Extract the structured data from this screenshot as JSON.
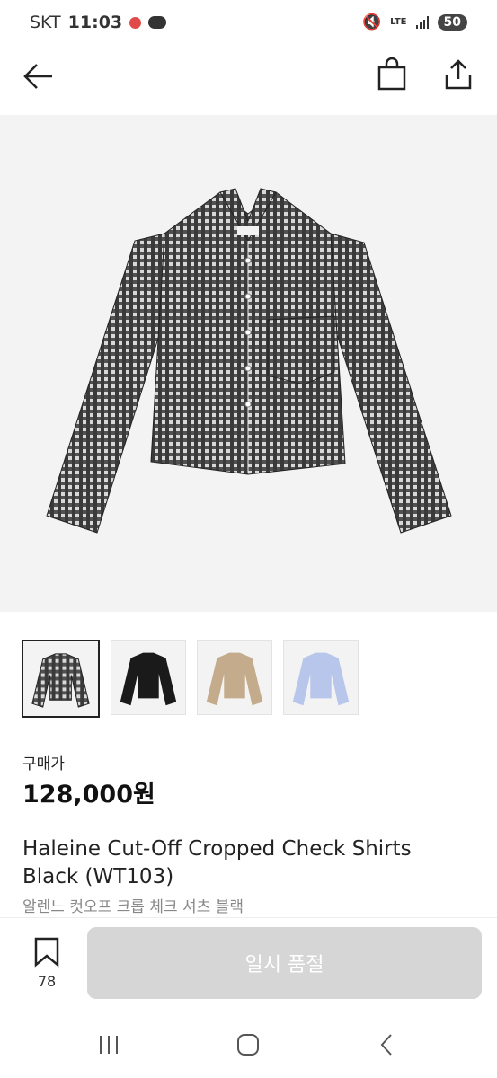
{
  "status_bar": {
    "carrier": "SKT",
    "time": "11:03",
    "network": "LTE",
    "battery": "50"
  },
  "app_bar": {
    "back_icon": "back-arrow-icon",
    "bag_icon": "shopping-bag-icon",
    "share_icon": "share-icon"
  },
  "product": {
    "price_label": "구매가",
    "price": "128,000원",
    "title": "Haleine Cut-Off Cropped Check Shirts Black (WT103)",
    "subtitle": "알렌느 컷오프 크롭 체크 셔츠 블랙",
    "thumbnails": [
      {
        "color_name": "check-black",
        "color": "#444444",
        "selected": true
      },
      {
        "color_name": "black",
        "color": "#1a1a1a",
        "selected": false
      },
      {
        "color_name": "beige",
        "color": "#c3ab8c",
        "selected": false
      },
      {
        "color_name": "light-blue",
        "color": "#b7c6ea",
        "selected": false
      }
    ]
  },
  "bottom_bar": {
    "bookmark_count": "78",
    "buy_button_label": "일시 품절"
  },
  "nav_bar": {
    "recents_icon": "recents-icon",
    "home_icon": "home-icon",
    "back_icon": "nav-back-icon"
  }
}
